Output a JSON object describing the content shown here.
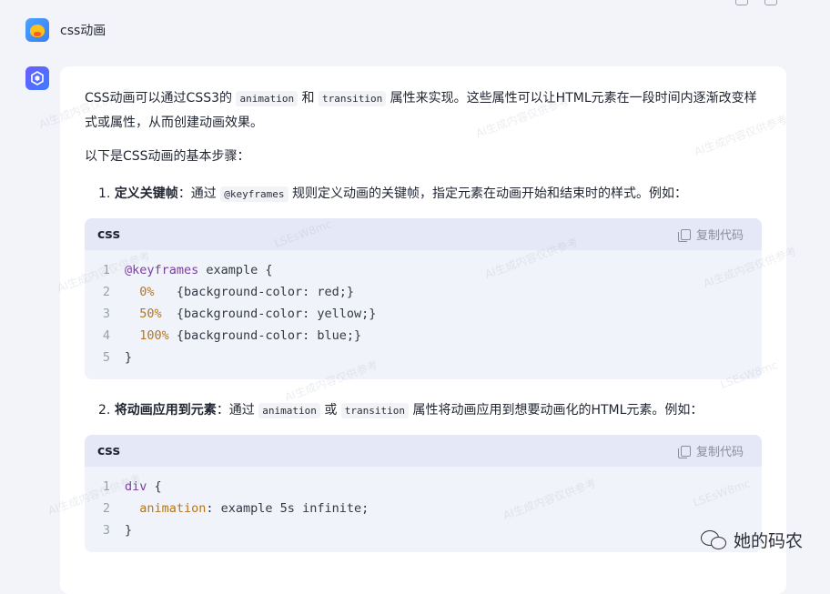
{
  "conversation": {
    "user_prompt": "css动画"
  },
  "answer": {
    "intro_before_animation": "CSS动画可以通过CSS3的 ",
    "animation_code": "animation",
    "and": " 和 ",
    "transition_code": "transition",
    "intro_after": " 属性来实现。这些属性可以让HTML元素在一段时间内逐渐改变样式或属性，从而创建动画效果。",
    "steps_intro": "以下是CSS动画的基本步骤：",
    "step1": {
      "number": "1.",
      "title": "定义关键帧",
      "pre": "：通过 ",
      "code": "@keyframes",
      "post": " 规则定义动画的关键帧，指定元素在动画开始和结束时的样式。例如："
    },
    "step2": {
      "number": "2.",
      "title": "将动画应用到元素",
      "pre": "：通过 ",
      "code1": "animation",
      "or": " 或 ",
      "code2": "transition",
      "post": " 属性将动画应用到想要动画化的HTML元素。例如："
    }
  },
  "code_block_1": {
    "lang": "css",
    "copy_label": "复制代码",
    "lines": [
      {
        "n": "1",
        "a": "@keyframes",
        "b": " example {"
      },
      {
        "n": "2",
        "a": "  0%",
        "b": "   {background-color: red;}"
      },
      {
        "n": "3",
        "a": "  50%",
        "b": "  {background-color: yellow;}"
      },
      {
        "n": "4",
        "a": "  100%",
        "b": " {background-color: blue;}"
      },
      {
        "n": "5",
        "a": "",
        "b": "}"
      }
    ]
  },
  "code_block_2": {
    "lang": "css",
    "copy_label": "复制代码",
    "lines": [
      {
        "n": "1",
        "a": "div",
        "b": " {"
      },
      {
        "n": "2",
        "a": "  animation",
        "b": ": example 5s infinite;"
      },
      {
        "n": "3",
        "a": "",
        "b": "}"
      }
    ]
  },
  "watermarks": [
    "AI生成内容仅供参考",
    "LSEsW8mc"
  ],
  "brand": "她的码农",
  "colors": {
    "page_bg": "#f3f4f9",
    "code_header_bg": "#e4e8f7",
    "code_bg": "#f1f3fa",
    "keyword": "#7a3e9d",
    "number": "#b5761b"
  },
  "icons": [
    "duck-avatar-icon",
    "bot-logo-icon",
    "copy-icon",
    "wechat-icon"
  ]
}
